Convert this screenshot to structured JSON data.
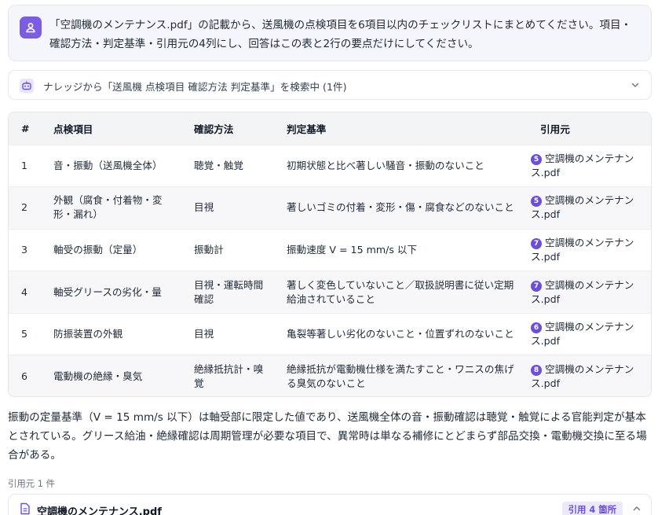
{
  "prompt": {
    "text": "「空調機のメンテナンス.pdf」の記載から、送風機の点検項目を6項目以内のチェックリストにまとめてください。項目・確認方法・判定基準・引用元の4列にし、回答はこの表と2行の要点だけにしてください。"
  },
  "search": {
    "text": "ナレッジから「送風機 点検項目 確認方法 判定基準」を検索中 (1件)"
  },
  "table": {
    "headers": [
      "#",
      "点検項目",
      "確認方法",
      "判定基準",
      "引用元"
    ],
    "rows": [
      {
        "num": "1",
        "item": "音・振動（送風機全体）",
        "method": "聴覚・触覚",
        "criteria": "初期状態と比べ著しい騒音・振動のないこと",
        "cite_badge": "5",
        "cite": "空調機のメンテナンス.pdf"
      },
      {
        "num": "2",
        "item": "外観（腐食・付着物・変形・漏れ）",
        "method": "目視",
        "criteria": "著しいゴミの付着・変形・傷・腐食などのないこと",
        "cite_badge": "5",
        "cite": "空調機のメンテナンス.pdf"
      },
      {
        "num": "3",
        "item": "軸受の振動（定量）",
        "method": "振動計",
        "criteria": "振動速度 V = 15 mm/s 以下",
        "cite_badge": "7",
        "cite": "空調機のメンテナンス.pdf"
      },
      {
        "num": "4",
        "item": "軸受グリースの劣化・量",
        "method": "目視・運転時間確認",
        "criteria": "著しく変色していないこと／取扱説明書に従い定期給油されていること",
        "cite_badge": "7",
        "cite": "空調機のメンテナンス.pdf"
      },
      {
        "num": "5",
        "item": "防振装置の外観",
        "method": "目視",
        "criteria": "亀裂等著しい劣化のないこと・位置ずれのないこと",
        "cite_badge": "6",
        "cite": "空調機のメンテナンス.pdf"
      },
      {
        "num": "6",
        "item": "電動機の絶縁・臭気",
        "method": "絶縁抵抗計・嗅覚",
        "criteria": "絶縁抵抗が電動機仕様を満たすこと・ワニスの焦げる臭気のないこと",
        "cite_badge": "8",
        "cite": "空調機のメンテナンス.pdf"
      }
    ]
  },
  "summary": {
    "text": "振動の定量基準（V = 15 mm/s 以下）は軸受部に限定した値であり、送風機全体の音・振動確認は聴覚・触覚による官能判定が基本とされている。グリース給油・絶縁確認は周期管理が必要な項目で、異常時は単なる補修にとどまらず部品交換・電動機交換に至る場合がある。"
  },
  "citations": {
    "count_label": "引用元 1 件",
    "source_name": "空調機のメンテナンス.pdf",
    "source_badge": "引用 4 箇所"
  },
  "colors": {
    "accent": "#6d4ed6",
    "avatar": "#7c5ce0"
  }
}
